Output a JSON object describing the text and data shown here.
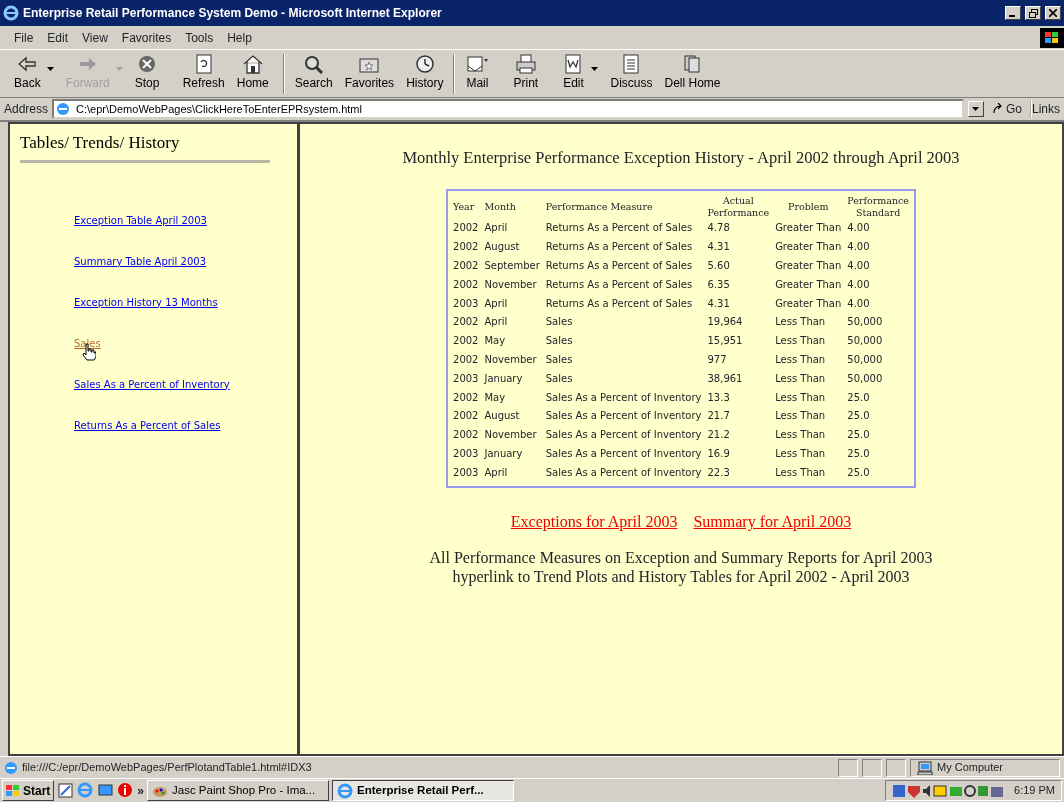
{
  "window": {
    "title": "Enterprise Retail Performance System Demo - Microsoft Internet Explorer"
  },
  "menu": [
    "File",
    "Edit",
    "View",
    "Favorites",
    "Tools",
    "Help"
  ],
  "toolbar": [
    {
      "label": "Back",
      "kind": "back",
      "disabled": false,
      "dropdown": true
    },
    {
      "label": "Forward",
      "kind": "forward",
      "disabled": true,
      "dropdown": true
    },
    {
      "label": "Stop",
      "kind": "stop",
      "disabled": false,
      "dropdown": false
    },
    {
      "label": "Refresh",
      "kind": "refresh",
      "disabled": false,
      "dropdown": false
    },
    {
      "label": "Home",
      "kind": "home",
      "disabled": false,
      "dropdown": false
    },
    {
      "label": "Search",
      "kind": "search",
      "disabled": false,
      "dropdown": false
    },
    {
      "label": "Favorites",
      "kind": "favorites",
      "disabled": false,
      "dropdown": false
    },
    {
      "label": "History",
      "kind": "history",
      "disabled": false,
      "dropdown": false
    },
    {
      "label": "Mail",
      "kind": "mail",
      "disabled": false,
      "dropdown": false
    },
    {
      "label": "Print",
      "kind": "print",
      "disabled": false,
      "dropdown": false
    },
    {
      "label": "Edit",
      "kind": "edit",
      "disabled": false,
      "dropdown": true
    },
    {
      "label": "Discuss",
      "kind": "discuss",
      "disabled": false,
      "dropdown": false
    },
    {
      "label": "Dell Home",
      "kind": "dell",
      "disabled": false,
      "dropdown": false
    }
  ],
  "address": {
    "label": "Address",
    "value": "C:\\epr\\DemoWebPages\\ClickHereToEnterEPRsystem.html",
    "go": "Go",
    "links": "Links"
  },
  "sidebar": {
    "title": "Tables/ Trends/ History",
    "links": [
      {
        "label": "Exception Table April 2003",
        "hovered": false
      },
      {
        "label": "Summary Table April 2003",
        "hovered": false
      },
      {
        "label": "Exception History 13 Months",
        "hovered": false
      },
      {
        "label": "Sales",
        "hovered": true
      },
      {
        "label": "Sales As a Percent of Inventory",
        "hovered": false
      },
      {
        "label": "Returns As a Percent of Sales",
        "hovered": false
      }
    ]
  },
  "main": {
    "heading": "Monthly Enterprise Performance Exception History - April 2002 through April 2003",
    "table": {
      "columns": [
        "Year",
        "Month",
        "Performance Measure",
        "Actual Performance",
        "Problem",
        "Performance Standard"
      ],
      "rows": [
        [
          "2002",
          "April",
          "Returns As a Percent of Sales",
          "4.78",
          "Greater Than",
          "4.00"
        ],
        [
          "2002",
          "August",
          "Returns As a Percent of Sales",
          "4.31",
          "Greater Than",
          "4.00"
        ],
        [
          "2002",
          "September",
          "Returns As a Percent of Sales",
          "5.60",
          "Greater Than",
          "4.00"
        ],
        [
          "2002",
          "November",
          "Returns As a Percent of Sales",
          "6.35",
          "Greater Than",
          "4.00"
        ],
        [
          "2003",
          "April",
          "Returns As a Percent of Sales",
          "4.31",
          "Greater Than",
          "4.00"
        ],
        [
          "2002",
          "April",
          "Sales",
          "19,964",
          "Less Than",
          "50,000"
        ],
        [
          "2002",
          "May",
          "Sales",
          "15,951",
          "Less Than",
          "50,000"
        ],
        [
          "2002",
          "November",
          "Sales",
          "977",
          "Less Than",
          "50,000"
        ],
        [
          "2003",
          "January",
          "Sales",
          "38,961",
          "Less Than",
          "50,000"
        ],
        [
          "2002",
          "May",
          "Sales As a Percent of Inventory",
          "13.3",
          "Less Than",
          "25.0"
        ],
        [
          "2002",
          "August",
          "Sales As a Percent of Inventory",
          "21.7",
          "Less Than",
          "25.0"
        ],
        [
          "2002",
          "November",
          "Sales As a Percent of Inventory",
          "21.2",
          "Less Than",
          "25.0"
        ],
        [
          "2003",
          "January",
          "Sales As a Percent of Inventory",
          "16.9",
          "Less Than",
          "25.0"
        ],
        [
          "2003",
          "April",
          "Sales As a Percent of Inventory",
          "22.3",
          "Less Than",
          "25.0"
        ]
      ]
    },
    "links": [
      "Exceptions for April 2003",
      "Summary for April 2003"
    ],
    "note": [
      "All Performance Measures on Exception and Summary Reports for April 2003",
      "hyperlink to Trend Plots and History Tables for April 2002 - April 2003"
    ]
  },
  "status_bar": {
    "text": "file:///C:/epr/DemoWebPages/PerfPlotandTable1.html#IDX3",
    "zone": "My Computer"
  },
  "taskbar": {
    "start": "Start",
    "tasks": [
      {
        "label": "Jasc Paint Shop Pro - Ima...",
        "selected": false
      },
      {
        "label": "Enterprise Retail Perf...",
        "selected": true
      }
    ],
    "more": "»",
    "time": "6:19 PM"
  }
}
